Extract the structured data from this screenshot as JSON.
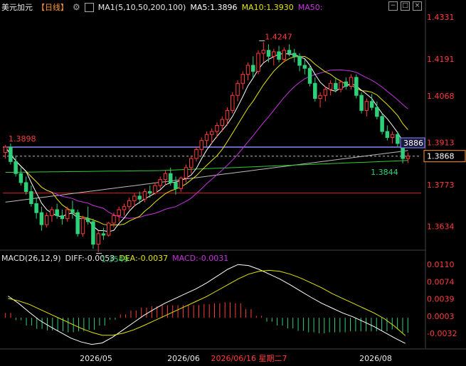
{
  "header": {
    "symbol": "美元加元",
    "period": "【日线】",
    "ma_title": "MA1(5,10,50,200,100)",
    "ma5": "MA5:1.3896",
    "ma10": "MA10:1.3930",
    "ma50": "MA50:"
  },
  "macd_header": {
    "title": "MACD(26,12,9)",
    "diff": "DIFF:-0.0053",
    "dea": "DEA:-0.0037",
    "macd": "MACD:-0.0031"
  },
  "colors": {
    "up": "#ff3b3b",
    "down": "#2fd07a",
    "ma5": "#ffffff",
    "ma10": "#e6e600",
    "ma50": "#c833e0",
    "ma100": "#33cc33",
    "ma200": "#bbbbbb",
    "resistance": "#8888ff",
    "support_red": "#dd2222",
    "current": "#ff9a2e"
  },
  "chart_data": [
    {
      "type": "candlestick",
      "title": "美元加元【日线】",
      "y_ticks": [
        "1.4331",
        "1.4191",
        "1.4068",
        "1.3913",
        "1.3868",
        "1.3773",
        "1.3634"
      ],
      "ylim": [
        1.356,
        1.434
      ],
      "x_ticks": [
        "2026/05",
        "2026/06",
        "2026/06/16 星期二7",
        "2026/08"
      ],
      "current_price_label": "1.3868",
      "cursor_price_label": "3886",
      "annotations": [
        {
          "text": "1.4247",
          "kind": "high"
        },
        {
          "text": "1.3898",
          "kind": "level"
        },
        {
          "text": "1.3549",
          "kind": "low"
        },
        {
          "text": "1.3844",
          "kind": "low"
        }
      ],
      "horizontal_levels": [
        {
          "name": "blue-level",
          "value": 1.3898
        },
        {
          "name": "dashed-current",
          "value": 1.3868
        },
        {
          "name": "red-level",
          "value": 1.3745
        }
      ],
      "candles": [
        [
          1.388,
          1.3905,
          1.386,
          1.3898
        ],
        [
          1.3898,
          1.391,
          1.384,
          1.385
        ],
        [
          1.385,
          1.387,
          1.38,
          1.381
        ],
        [
          1.381,
          1.383,
          1.377,
          1.378
        ],
        [
          1.378,
          1.38,
          1.374,
          1.375
        ],
        [
          1.375,
          1.377,
          1.37,
          1.371
        ],
        [
          1.371,
          1.373,
          1.366,
          1.368
        ],
        [
          1.368,
          1.37,
          1.362,
          1.364
        ],
        [
          1.364,
          1.368,
          1.363,
          1.367
        ],
        [
          1.367,
          1.37,
          1.365,
          1.369
        ],
        [
          1.369,
          1.371,
          1.366,
          1.367
        ],
        [
          1.367,
          1.369,
          1.364,
          1.366
        ],
        [
          1.366,
          1.37,
          1.365,
          1.369
        ],
        [
          1.369,
          1.372,
          1.366,
          1.368
        ],
        [
          1.368,
          1.369,
          1.36,
          1.361
        ],
        [
          1.361,
          1.367,
          1.36,
          1.366
        ],
        [
          1.366,
          1.37,
          1.364,
          1.365
        ],
        [
          1.365,
          1.366,
          1.356,
          1.3575
        ],
        [
          1.3575,
          1.362,
          1.3549,
          1.361
        ],
        [
          1.361,
          1.363,
          1.359,
          1.3605
        ],
        [
          1.3605,
          1.365,
          1.36,
          1.3645
        ],
        [
          1.3645,
          1.368,
          1.363,
          1.367
        ],
        [
          1.367,
          1.37,
          1.365,
          1.369
        ],
        [
          1.369,
          1.371,
          1.367,
          1.37
        ],
        [
          1.37,
          1.373,
          1.369,
          1.372
        ],
        [
          1.372,
          1.3745,
          1.37,
          1.3735
        ],
        [
          1.3735,
          1.375,
          1.371,
          1.3725
        ],
        [
          1.3725,
          1.376,
          1.3715,
          1.375
        ],
        [
          1.375,
          1.377,
          1.373,
          1.3745
        ],
        [
          1.3745,
          1.378,
          1.374,
          1.377
        ],
        [
          1.377,
          1.38,
          1.376,
          1.379
        ],
        [
          1.379,
          1.382,
          1.377,
          1.381
        ],
        [
          1.381,
          1.383,
          1.377,
          1.378
        ],
        [
          1.378,
          1.38,
          1.374,
          1.376
        ],
        [
          1.376,
          1.38,
          1.375,
          1.3795
        ],
        [
          1.3795,
          1.384,
          1.378,
          1.383
        ],
        [
          1.383,
          1.387,
          1.381,
          1.386
        ],
        [
          1.386,
          1.39,
          1.385,
          1.389
        ],
        [
          1.389,
          1.393,
          1.387,
          1.392
        ],
        [
          1.392,
          1.395,
          1.39,
          1.394
        ],
        [
          1.394,
          1.396,
          1.391,
          1.395
        ],
        [
          1.395,
          1.398,
          1.393,
          1.397
        ],
        [
          1.397,
          1.4,
          1.395,
          1.399
        ],
        [
          1.399,
          1.403,
          1.397,
          1.402
        ],
        [
          1.402,
          1.408,
          1.401,
          1.407
        ],
        [
          1.407,
          1.412,
          1.405,
          1.411
        ],
        [
          1.411,
          1.415,
          1.409,
          1.414
        ],
        [
          1.414,
          1.418,
          1.412,
          1.417
        ],
        [
          1.417,
          1.42,
          1.413,
          1.415
        ],
        [
          1.415,
          1.422,
          1.414,
          1.421
        ],
        [
          1.421,
          1.4247,
          1.418,
          1.422
        ],
        [
          1.422,
          1.424,
          1.418,
          1.42
        ],
        [
          1.42,
          1.4225,
          1.417,
          1.4215
        ],
        [
          1.4215,
          1.4235,
          1.418,
          1.419
        ],
        [
          1.419,
          1.423,
          1.418,
          1.422
        ],
        [
          1.422,
          1.424,
          1.42,
          1.421
        ],
        [
          1.421,
          1.4225,
          1.418,
          1.42
        ],
        [
          1.42,
          1.421,
          1.415,
          1.417
        ],
        [
          1.417,
          1.419,
          1.414,
          1.416
        ],
        [
          1.416,
          1.417,
          1.41,
          1.411
        ],
        [
          1.411,
          1.413,
          1.405,
          1.406
        ],
        [
          1.406,
          1.408,
          1.403,
          1.407
        ],
        [
          1.407,
          1.41,
          1.405,
          1.409
        ],
        [
          1.409,
          1.412,
          1.407,
          1.411
        ],
        [
          1.411,
          1.413,
          1.408,
          1.409
        ],
        [
          1.409,
          1.412,
          1.408,
          1.4115
        ],
        [
          1.4115,
          1.413,
          1.409,
          1.41
        ],
        [
          1.41,
          1.414,
          1.409,
          1.413
        ],
        [
          1.413,
          1.414,
          1.406,
          1.407
        ],
        [
          1.407,
          1.408,
          1.401,
          1.402
        ],
        [
          1.402,
          1.406,
          1.4,
          1.405
        ],
        [
          1.405,
          1.4075,
          1.402,
          1.403
        ],
        [
          1.403,
          1.405,
          1.399,
          1.4
        ],
        [
          1.4,
          1.401,
          1.394,
          1.395
        ],
        [
          1.395,
          1.397,
          1.392,
          1.393
        ],
        [
          1.393,
          1.395,
          1.391,
          1.394
        ],
        [
          1.394,
          1.395,
          1.39,
          1.391
        ],
        [
          1.391,
          1.392,
          1.3844,
          1.386
        ],
        [
          1.386,
          1.388,
          1.3845,
          1.3868
        ]
      ]
    },
    {
      "type": "bar+line",
      "title": "MACD(26,12,9)",
      "y_ticks": [
        "0.0110",
        "0.0074",
        "0.0039",
        "0.0003",
        "-0.0032"
      ],
      "ylim": [
        -0.006,
        0.0125
      ],
      "series": [
        {
          "name": "DIFF",
          "values": [
            0.0045,
            0.003,
            0.0012,
            -0.0005,
            -0.0018,
            -0.003,
            -0.0042,
            -0.005,
            -0.0055,
            -0.0052,
            -0.004,
            -0.0025,
            -0.001,
            0.0005,
            0.0018,
            0.003,
            0.004,
            0.005,
            0.006,
            0.0072,
            0.0086,
            0.01,
            0.011,
            0.0108,
            0.01,
            0.009,
            0.008,
            0.0068,
            0.0055,
            0.0042,
            0.003,
            0.002,
            0.001,
            0.0002,
            -0.0008,
            -0.0018,
            -0.003,
            -0.0042,
            -0.0053
          ]
        },
        {
          "name": "DEA",
          "values": [
            0.004,
            0.0035,
            0.0028,
            0.0018,
            0.0008,
            -0.0002,
            -0.0012,
            -0.0022,
            -0.003,
            -0.0036,
            -0.0036,
            -0.0032,
            -0.0025,
            -0.0016,
            -0.0006,
            0.0004,
            0.0014,
            0.0024,
            0.0034,
            0.0044,
            0.0056,
            0.0068,
            0.008,
            0.009,
            0.0096,
            0.0098,
            0.0096,
            0.009,
            0.0082,
            0.0072,
            0.0062,
            0.005,
            0.004,
            0.003,
            0.002,
            0.001,
            -0.0002,
            -0.0018,
            -0.0037
          ]
        },
        {
          "name": "MACD",
          "values": [
            0.001,
            -0.0005,
            -0.0016,
            -0.0023,
            -0.0026,
            -0.0028,
            -0.003,
            -0.0028,
            -0.0025,
            -0.0016,
            -0.0004,
            0.0007,
            0.0015,
            0.0021,
            0.0024,
            0.0026,
            0.0026,
            0.0026,
            0.0026,
            0.0028,
            0.003,
            0.0032,
            0.003,
            0.0018,
            0.0004,
            -0.0008,
            -0.0016,
            -0.0022,
            -0.0027,
            -0.003,
            -0.0032,
            -0.003,
            -0.003,
            -0.0028,
            -0.0028,
            -0.0028,
            -0.0028,
            -0.0024,
            -0.0031
          ]
        }
      ]
    }
  ]
}
